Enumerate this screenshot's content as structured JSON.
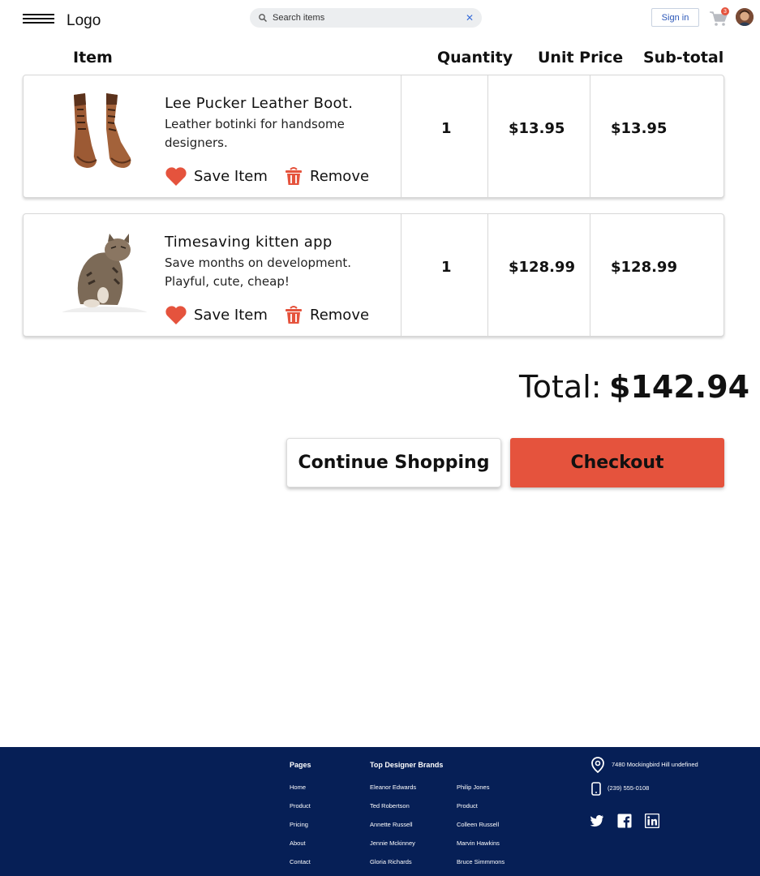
{
  "header": {
    "logo": "Logo",
    "search_placeholder": "Search items",
    "signin_label": "Sign in",
    "cart_count": "3",
    "icons": [
      "menu-icon",
      "search-icon",
      "close-icon",
      "cart-icon"
    ]
  },
  "table": {
    "columns": [
      "Item",
      "Quantity",
      "Unit Price",
      "Sub-total"
    ]
  },
  "items": [
    {
      "title": "Lee Pucker Leather Boot.",
      "desc_line1": "Leather botinki for handsome",
      "desc_line2": "designers.",
      "save_label": "Save Item",
      "remove_label": "Remove",
      "quantity": "1",
      "unit_price": "$13.95",
      "subtotal": "$13.95"
    },
    {
      "title": "Timesaving kitten app",
      "desc_line1": "Save months on development.",
      "desc_line2": "Playful, cute, cheap!",
      "save_label": "Save Item",
      "remove_label": "Remove",
      "quantity": "1",
      "unit_price": "$128.99",
      "subtotal": "$128.99"
    }
  ],
  "summary": {
    "total_label": "Total:",
    "total_value": "$142.94",
    "continue_label": "Continue Shopping",
    "checkout_label": "Checkout"
  },
  "colors": {
    "accent": "#e5533d",
    "footer_bg": "#061f56",
    "link_blue": "#2a56b8"
  },
  "footer": {
    "pages_heading": "Pages",
    "pages": [
      "Home",
      "Product",
      "Pricing",
      "About",
      "Contact"
    ],
    "brands_heading": "Top  Designer Brands",
    "brands_col1": [
      "Eleanor Edwards",
      "Ted Robertson",
      "Annette Russell",
      "Jennie Mckinney",
      "Gloria Richards"
    ],
    "brands_col2": [
      "Philip Jones",
      "Product",
      "Colleen Russell",
      "Marvin Hawkins",
      "Bruce Simmmons"
    ],
    "address": "7480 Mockingbird Hill undefined",
    "phone": "(239) 555-0108",
    "social": [
      "twitter-icon",
      "facebook-icon",
      "linkedin-icon"
    ]
  }
}
